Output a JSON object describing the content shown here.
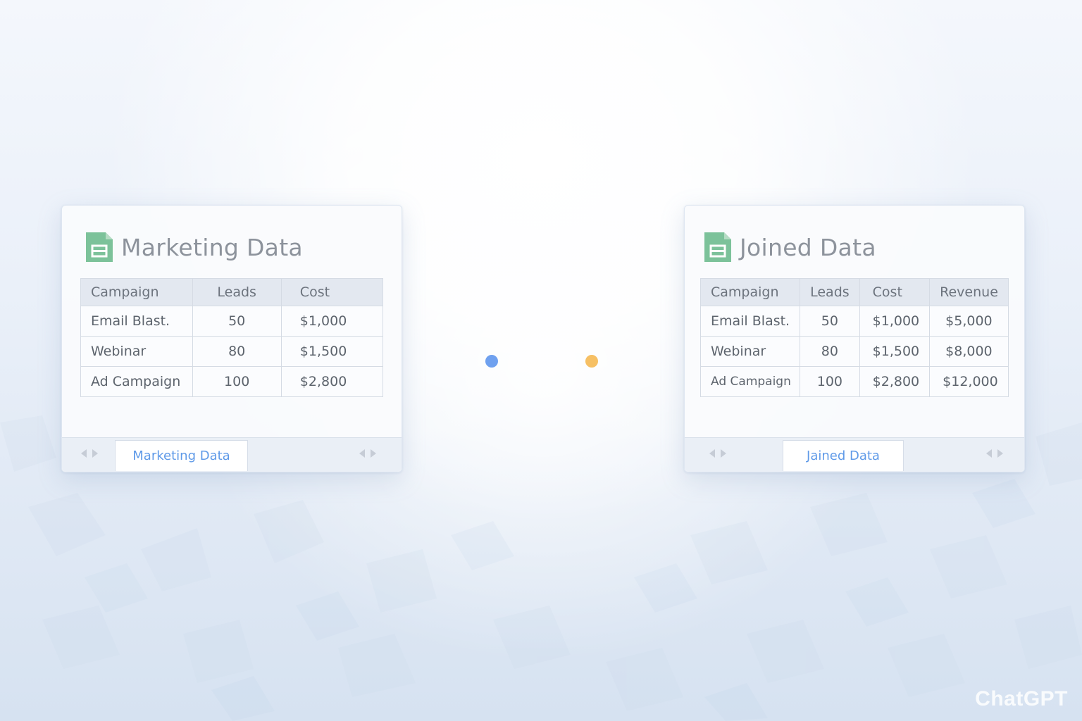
{
  "left_panel": {
    "title": "Marketing Data",
    "columns": [
      "Campaign",
      "Leads",
      "Cost"
    ],
    "rows": [
      [
        "Email Blast.",
        "50",
        "$1,000"
      ],
      [
        "Webinar",
        "80",
        "$1,500"
      ],
      [
        "Ad Campaign",
        "100",
        "$2,800"
      ]
    ],
    "sheet_tab": "Marketing Data"
  },
  "right_panel": {
    "title": "Joined Data",
    "columns": [
      "Campaign",
      "Leads",
      "Cost",
      "Revenue"
    ],
    "rows": [
      [
        "Email Blast.",
        "50",
        "$1,000",
        "$5,000"
      ],
      [
        "Webinar",
        "80",
        "$1,500",
        "$8,000"
      ],
      [
        "Ad Campaign",
        "100",
        "$2,800",
        "$12,000"
      ]
    ],
    "sheet_tab": "Jained Data"
  },
  "connector": {
    "left_color": "#6fa1ef",
    "right_color": "#f6c064"
  },
  "colors": {
    "sheet_icon": "#7cc29a",
    "tab_text": "#5f9ae8"
  },
  "icons": [
    "sheets-icon",
    "arrow-left-icon",
    "arrow-right-icon"
  ],
  "watermark": "ChatGPT"
}
